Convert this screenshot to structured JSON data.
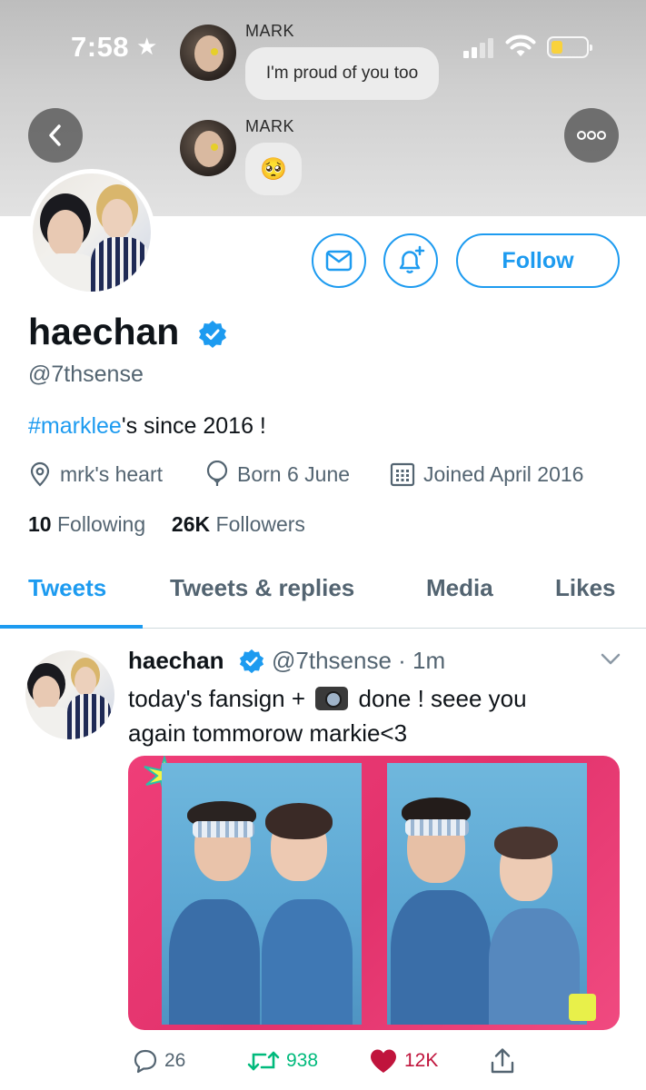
{
  "status_bar": {
    "time": "7:58",
    "star_icon": "★",
    "battery_color": "#f9d23c"
  },
  "dm_previews": [
    {
      "sender": "MARK",
      "message": "I'm proud of you too"
    },
    {
      "sender": "MARK",
      "message": "🥺"
    }
  ],
  "profile": {
    "display_name": "haechan",
    "handle": "@7thsense",
    "bio_tag": "#marklee",
    "bio_rest": "'s since 2016 !",
    "location": "mrk's heart",
    "birthday": "Born 6 June",
    "joined": "Joined April 2016",
    "following_count": "10",
    "following_label": "Following",
    "followers_count": "26K",
    "followers_label": "Followers",
    "follow_button": "Follow",
    "accent_color": "#1d9bf0"
  },
  "tabs": [
    {
      "label": "Tweets",
      "active": true
    },
    {
      "label": "Tweets & replies",
      "active": false
    },
    {
      "label": "Media",
      "active": false
    },
    {
      "label": "Likes",
      "active": false
    }
  ],
  "tweet": {
    "name": "haechan",
    "handle_time": "@7thsense · 1m",
    "text_part1": "today's fansign +",
    "text_part2": "done ! seee you",
    "text_line2": "again tommorow markie<3",
    "replies": "26",
    "retweets": "938",
    "likes": "12K",
    "retweet_color": "#00ba7c",
    "like_color": "#c0143c"
  }
}
